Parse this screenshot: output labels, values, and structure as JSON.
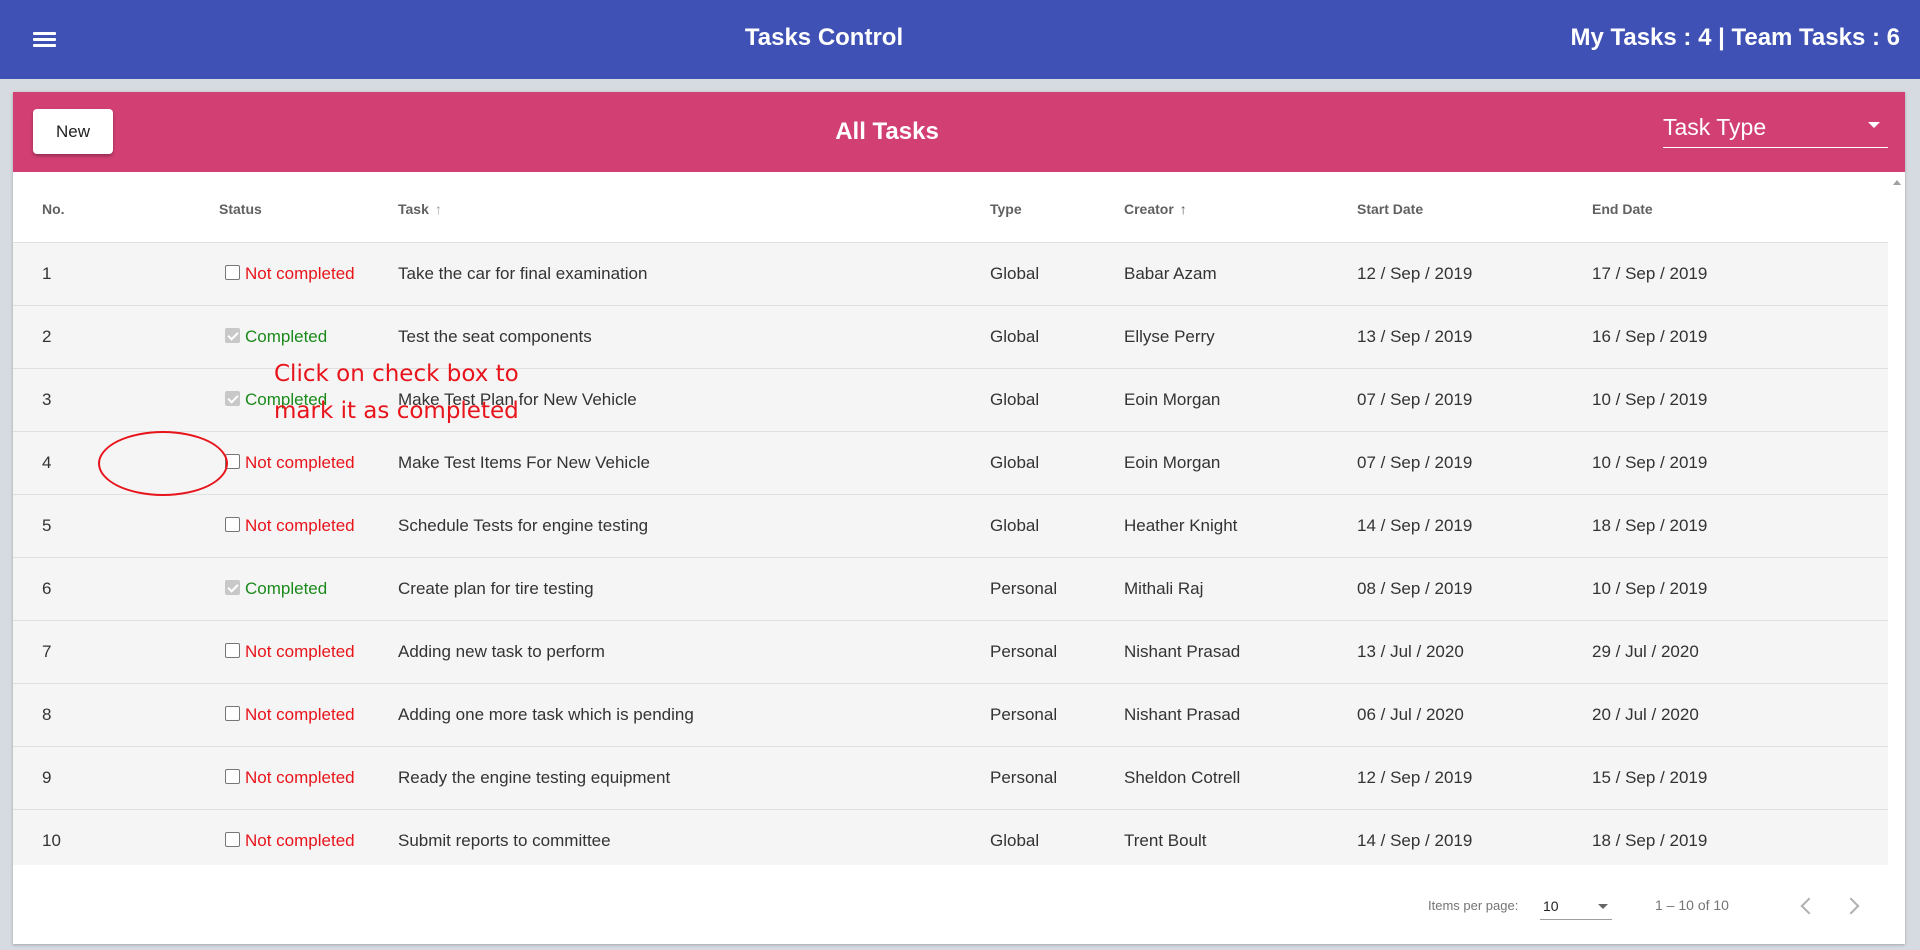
{
  "app": {
    "title": "Tasks Control",
    "counts": "My Tasks : 4 | Team Tasks : 6",
    "accent": "#3f51b5"
  },
  "card": {
    "new_label": "New",
    "title": "All Tasks",
    "task_type_label": "Task Type",
    "accent": "#d23f73"
  },
  "table": {
    "headers": {
      "no": "No.",
      "status": "Status",
      "task": "Task",
      "type": "Type",
      "creator": "Creator",
      "start": "Start Date",
      "end": "End Date"
    },
    "rows": [
      {
        "no": "1",
        "checked": false,
        "status": "Not completed",
        "task": "Take the car for final examination",
        "type": "Global",
        "creator": "Babar Azam",
        "start": "12 / Sep / 2019",
        "end": "17 / Sep / 2019"
      },
      {
        "no": "2",
        "checked": true,
        "status": "Completed",
        "task": "Test the seat components",
        "type": "Global",
        "creator": "Ellyse Perry",
        "start": "13 / Sep / 2019",
        "end": "16 / Sep / 2019"
      },
      {
        "no": "3",
        "checked": true,
        "status": "Completed",
        "task": "Make Test Plan for New Vehicle",
        "type": "Global",
        "creator": "Eoin Morgan",
        "start": "07 / Sep / 2019",
        "end": "10 / Sep / 2019"
      },
      {
        "no": "4",
        "checked": false,
        "status": "Not completed",
        "task": "Make Test Items For New Vehicle",
        "type": "Global",
        "creator": "Eoin Morgan",
        "start": "07 / Sep / 2019",
        "end": "10 / Sep / 2019"
      },
      {
        "no": "5",
        "checked": false,
        "status": "Not completed",
        "task": "Schedule Tests for engine testing",
        "type": "Global",
        "creator": "Heather Knight",
        "start": "14 / Sep / 2019",
        "end": "18 / Sep / 2019"
      },
      {
        "no": "6",
        "checked": true,
        "status": "Completed",
        "task": "Create plan for tire testing",
        "type": "Personal",
        "creator": "Mithali Raj",
        "start": "08 / Sep / 2019",
        "end": "10 / Sep / 2019"
      },
      {
        "no": "7",
        "checked": false,
        "status": "Not completed",
        "task": "Adding new task to perform",
        "type": "Personal",
        "creator": "Nishant Prasad",
        "start": "13 / Jul / 2020",
        "end": "29 / Jul / 2020"
      },
      {
        "no": "8",
        "checked": false,
        "status": "Not completed",
        "task": "Adding one more task which is pending",
        "type": "Personal",
        "creator": "Nishant Prasad",
        "start": "06 / Jul / 2020",
        "end": "20 / Jul / 2020"
      },
      {
        "no": "9",
        "checked": false,
        "status": "Not completed",
        "task": "Ready the engine testing equipment",
        "type": "Personal",
        "creator": "Sheldon Cotrell",
        "start": "12 / Sep / 2019",
        "end": "15 / Sep / 2019"
      },
      {
        "no": "10",
        "checked": false,
        "status": "Not completed",
        "task": "Submit reports to committee",
        "type": "Global",
        "creator": "Trent Boult",
        "start": "14 / Sep / 2019",
        "end": "18 / Sep / 2019"
      }
    ]
  },
  "paginator": {
    "items_per_page_label": "Items per page:",
    "items_per_page_value": "10",
    "range": "1 – 10 of 10"
  },
  "annotation": {
    "text": "Click on check box to\nmark it as completed",
    "color": "#e8141b"
  },
  "status_colors": {
    "completed": "#1a8a1a",
    "not_completed": "#e8141b"
  }
}
